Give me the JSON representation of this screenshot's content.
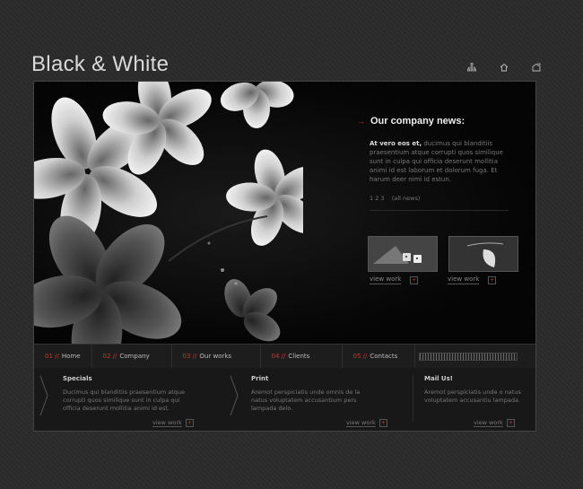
{
  "logo": "Black & White",
  "top_icons": [
    "sitemap-icon",
    "home-icon",
    "mail-icon"
  ],
  "news": {
    "title": "Our company news:",
    "lead": "At vero eos et,",
    "body": "ducimus qui blanditiis praesentium atque corrupti quos similique sunt in culpa qui officia deserunt mollitia animi id est laborum et dolorum fuga. Et harum deer nimi id estun.",
    "pages": "1 2 3",
    "all_news": "(all news)"
  },
  "view_work": "view work",
  "nav": [
    {
      "num": "01 //",
      "label": "Home"
    },
    {
      "num": "02 //",
      "label": "Company"
    },
    {
      "num": "03 //",
      "label": "Our works"
    },
    {
      "num": "04 //",
      "label": "Clients"
    },
    {
      "num": "05 //",
      "label": "Contacts"
    }
  ],
  "columns": [
    {
      "title": "Specials",
      "text": "Ducimus qui blanditiis praesentium atque corrupti quos similique sunt in culpa qui officia deserunt mollitia animi id est."
    },
    {
      "title": "Print",
      "text": "Aremot perspiciatis unde omnis de la natus voluptatem accusantium pers lampada delo."
    },
    {
      "title": "Mail Us!",
      "text": "Aremot perspiciatis unde o natus voluptatem accusantiu lampada."
    }
  ],
  "colors": {
    "accent": "#c0392b",
    "background": "#2b2b2b",
    "panel": "#0a0a0a"
  }
}
